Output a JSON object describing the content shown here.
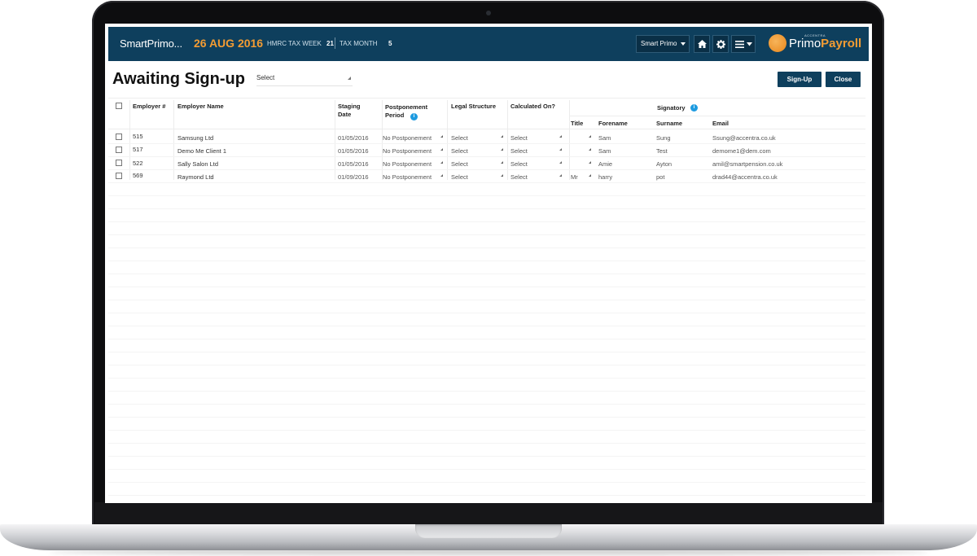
{
  "header": {
    "app_title": "SmartPrimo...",
    "date": "26 AUG 2016",
    "tax_week_label": "HMRC TAX WEEK",
    "tax_week_value": "21",
    "tax_month_label": "TAX MONTH",
    "tax_month_value": "5",
    "company_select": "Smart Primo",
    "logo_small": "ACCENTRA",
    "logo_primo": "Primo",
    "logo_payroll": "Payroll",
    "brand_color": "#0e3f5d",
    "accent_color": "#f39c33"
  },
  "page": {
    "title": "Awaiting Sign-up",
    "filter_select": "Select",
    "signup_label": "Sign-Up",
    "close_label": "Close"
  },
  "table": {
    "columns": {
      "employer_no": "Employer #",
      "employer_name": "Employer Name",
      "staging_date_1": "Staging",
      "staging_date_2": "Date",
      "postponement_1": "Postponement",
      "postponement_2": "Period",
      "legal_structure": "Legal Structure",
      "calculated_on": "Calculated On?",
      "signatory": "Signatory",
      "title": "Title",
      "forename": "Forename",
      "surname": "Surname",
      "email": "Email"
    },
    "rows": [
      {
        "id": "515",
        "name": "Samsung Ltd",
        "staging": "01/05/2016",
        "postponement": "No Postponement",
        "legal": "Select",
        "calc": "Select",
        "title": "",
        "forename": "Sam",
        "surname": "Sung",
        "email": "Ssung@accentra.co.uk"
      },
      {
        "id": "517",
        "name": "Demo Me Client 1",
        "staging": "01/05/2016",
        "postponement": "No Postponement",
        "legal": "Select",
        "calc": "Select",
        "title": "",
        "forename": "Sam",
        "surname": "Test",
        "email": "demome1@dem.com"
      },
      {
        "id": "522",
        "name": "Sally Salon Ltd",
        "staging": "01/05/2016",
        "postponement": "No Postponement",
        "legal": "Select",
        "calc": "Select",
        "title": "",
        "forename": "Amie",
        "surname": "Ayton",
        "email": "amil@smartpension.co.uk"
      },
      {
        "id": "569",
        "name": "Raymond Ltd",
        "staging": "01/09/2016",
        "postponement": "No Postponement",
        "legal": "Select",
        "calc": "Select",
        "title": "Mr",
        "forename": "harry",
        "surname": "pot",
        "email": "drad44@accentra.co.uk"
      }
    ]
  }
}
